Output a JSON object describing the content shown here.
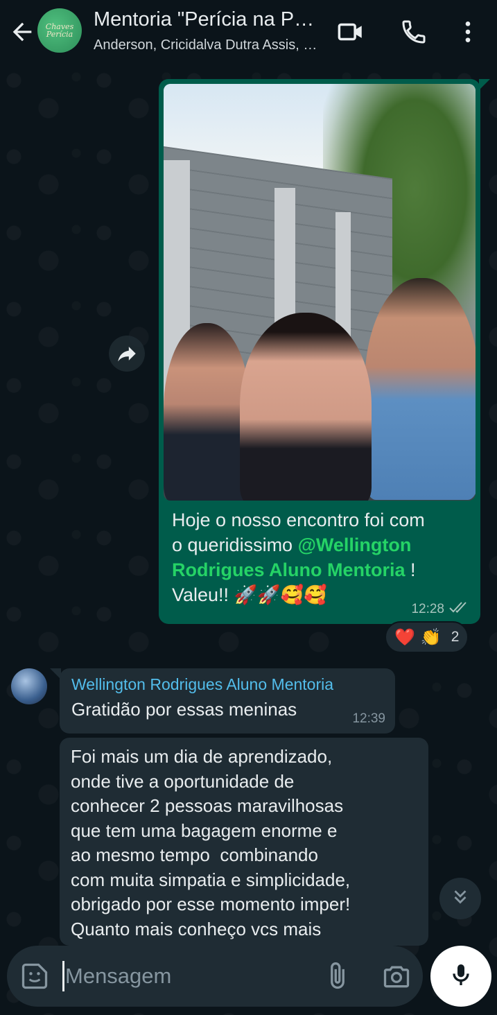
{
  "header": {
    "title": "Mentoria \"Perícia na Prática\"",
    "subtitle": "Anderson, Cricidalva Dutra Assis, Wellington",
    "avatar_text_line1": "Chaves",
    "avatar_text_line2": "Perícia"
  },
  "messages": {
    "outgoing": {
      "text_line1": "Hoje o nosso encontro foi com",
      "text_line2": "o queridissimo ",
      "mention": "@Wellington Rodrigues Aluno Mentoria",
      "text_after_mention": " !",
      "text_line4": "Valeu!! ",
      "emojis": "🚀🚀🥰🥰",
      "time": "12:28",
      "status": "read"
    },
    "reactions": {
      "emojis": [
        "❤️",
        "👏"
      ],
      "count": "2"
    },
    "incoming_1": {
      "sender": "Wellington Rodrigues Aluno Mentoria",
      "text": "Gratidão por essas meninas",
      "time": "12:39"
    },
    "incoming_2": {
      "text": "Foi mais um dia de aprendizado,\nonde tive a oportunidade de\nconhecer 2 pessoas maravilhosas\nque tem uma bagagem enorme e\nao mesmo tempo  combinando\ncom muita simpatia e simplicidade,\nobrigado por esse momento imper!\nQuanto mais conheço vcs mais"
    }
  },
  "composer": {
    "placeholder": "Mensagem"
  },
  "colors": {
    "outgoing_bubble": "#005c4b",
    "incoming_bubble": "#1f2c34",
    "mention": "#25d366",
    "sender_name": "#53bdeb",
    "background": "#0b141a"
  },
  "icons": [
    "back-arrow-icon",
    "video-call-icon",
    "phone-icon",
    "more-vert-icon",
    "forward-icon",
    "double-chevron-down-icon",
    "sticker-icon",
    "paperclip-icon",
    "camera-icon",
    "mic-icon",
    "double-check-icon"
  ]
}
